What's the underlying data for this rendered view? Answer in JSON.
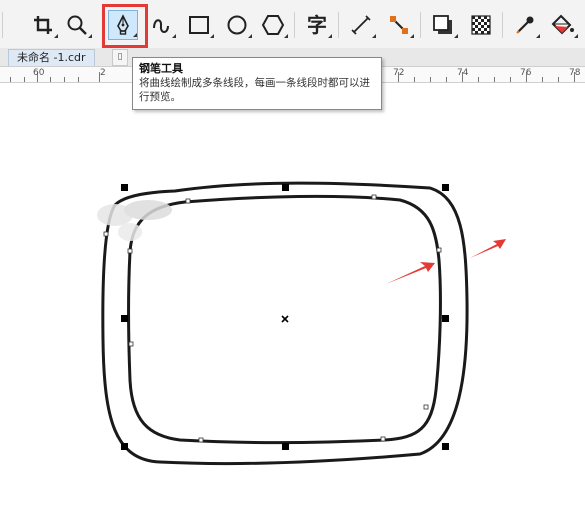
{
  "document_tab": {
    "label": "未命名 -1.cdr",
    "extra_tab_icon": "page-icon"
  },
  "ruler": {
    "labels": [
      "60",
      "2",
      "72",
      "74",
      "76",
      "78"
    ]
  },
  "tooltip": {
    "title": "钢笔工具",
    "description": "将曲线绘制成多条线段，每画一条线段时都可以进行预览。"
  },
  "toolbar": {
    "tools": [
      {
        "name": "crop-tool",
        "icon": "crop-icon"
      },
      {
        "name": "zoom-tool",
        "icon": "magnifier-icon"
      },
      {
        "name": "pen-tool",
        "icon": "pen-nib-icon",
        "selected": true
      },
      {
        "name": "bspline-tool",
        "icon": "curve-icon"
      },
      {
        "name": "rectangle-tool",
        "icon": "rectangle-icon"
      },
      {
        "name": "ellipse-tool",
        "icon": "ellipse-icon"
      },
      {
        "name": "polygon-tool",
        "icon": "hexagon-icon"
      },
      {
        "name": "text-tool",
        "icon": "text-icon",
        "label": "字"
      },
      {
        "name": "dimension-tool",
        "icon": "dimension-icon"
      },
      {
        "name": "connector-tool",
        "icon": "connector-icon"
      },
      {
        "name": "shadow-tool",
        "icon": "drop-shadow-icon"
      },
      {
        "name": "transparency-tool",
        "icon": "checkerboard-icon"
      },
      {
        "name": "eyedropper-tool",
        "icon": "eyedropper-icon"
      },
      {
        "name": "fill-tool",
        "icon": "paint-bucket-icon"
      }
    ]
  },
  "colors": {
    "highlight": "#e53935",
    "arrow": "#e53935",
    "curve": "#1a1a1a"
  }
}
